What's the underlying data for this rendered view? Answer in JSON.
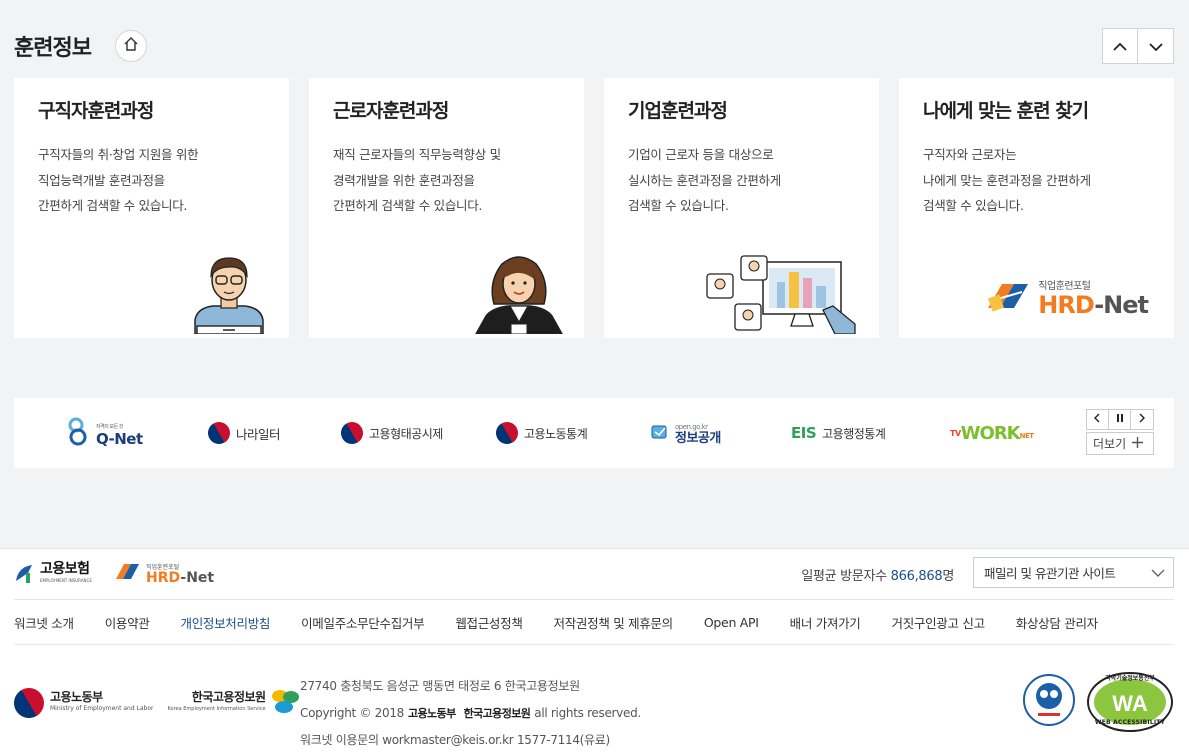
{
  "section": {
    "title": "훈련정보"
  },
  "cards": [
    {
      "title": "구직자훈련과정",
      "lines": [
        "구직자들의 취·창업 지원을 위한",
        "직업능력개발 훈련과정을",
        "간편하게 검색할 수 있습니다."
      ]
    },
    {
      "title": "근로자훈련과정",
      "lines": [
        "재직 근로자들의 직무능력향상 및",
        "경력개발을 위한 훈련과정을",
        "간편하게 검색할 수 있습니다."
      ]
    },
    {
      "title": "기업훈련과정",
      "lines": [
        "기업이 근로자 등을 대상으로",
        "실시하는 훈련과정을 간편하게",
        "검색할 수 있습니다."
      ]
    },
    {
      "title": "나에게 맞는 훈련 찾기",
      "lines": [
        "구직자와 근로자는",
        "나에게 맞는 훈련과정을 간편하게",
        "검색할 수 있습니다."
      ]
    }
  ],
  "hrd_logo": {
    "small": "직업훈련포털",
    "big1": "HRD",
    "big2": "-Net"
  },
  "partner_sites": [
    {
      "name": "Q-Net",
      "sub": "자격의 모든 것"
    },
    {
      "name": "나라일터"
    },
    {
      "name": "고용형태공시제"
    },
    {
      "name": "고용노동통계"
    },
    {
      "name": "정보공개",
      "sub": "open.go.kr"
    },
    {
      "name": "고용행정통계",
      "prefix": "EIS"
    },
    {
      "name": "WORK",
      "prefix": "TV",
      "suffix": "NET"
    }
  ],
  "partner_controls": {
    "more": "더보기"
  },
  "footer": {
    "insurance_logo": {
      "name": "고용보험",
      "sub": "EMPLOYMENT INSURANCE"
    },
    "hrd_logo": {
      "small": "직업훈련포털",
      "big1": "HRD",
      "big2": "-Net"
    },
    "visitors_label": "일평균 방문자수",
    "visitors_count": "866,868",
    "visitors_unit": "명",
    "family_select": "패밀리 및 유관기관 사이트",
    "links": [
      "워크넷 소개",
      "이용약관",
      "개인정보처리방침",
      "이메일주소무단수집거부",
      "웹접근성정책",
      "저작권정책 및 제휴문의",
      "Open API",
      "배너 가져가기",
      "거짓구인광고 신고",
      "화상상담 관리자"
    ],
    "moel": {
      "name": "고용노동부",
      "en": "Ministry of Employment and Labor"
    },
    "keis": {
      "name": "한국고용정보원",
      "en": "Korea Employment Information Service"
    },
    "address": "27740 충청북도 음성군 맹동면 태정로 6 한국고용정보원",
    "copyright_pre": "Copyright © 2018",
    "copyright_org1": "고용노동부",
    "copyright_org2": "한국고용정보원",
    "copyright_post": "all rights reserved.",
    "contact": "워크넷 이용문의 workmaster@keis.or.kr 1577-7114(유료)",
    "wa_mark": "WEB ACCESSIBILITY",
    "wa_top": "과학기술정보통신부"
  },
  "colors": {
    "accent": "#1b4f8c",
    "hrd_orange": "#f47c20",
    "hrd_blue": "#1b5fa8"
  }
}
